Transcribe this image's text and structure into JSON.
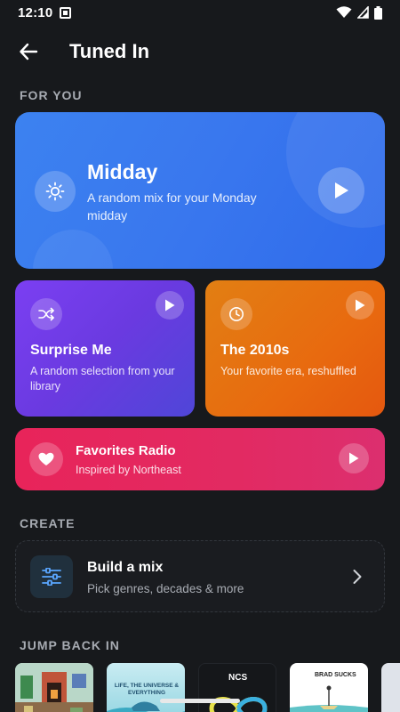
{
  "status_bar": {
    "time": "12:10"
  },
  "header": {
    "title": "Tuned In"
  },
  "sections": {
    "for_you": "FOR YOU",
    "create": "CREATE",
    "jump_back_in": "JUMP BACK IN"
  },
  "hero": {
    "title": "Midday",
    "subtitle": "A random mix for your Monday midday",
    "icon": "sun-icon",
    "color": "#3a7cf0"
  },
  "cards": [
    {
      "title": "Surprise Me",
      "subtitle": "A random selection from your library",
      "icon": "shuffle-icon",
      "color": "#6f3ee8"
    },
    {
      "title": "The 2010s",
      "subtitle": "Your favorite era, reshuffled",
      "icon": "clock-icon",
      "color": "#e8720f"
    }
  ],
  "favorites": {
    "title": "Favorites Radio",
    "subtitle": "Inspired by Northeast",
    "icon": "heart-icon",
    "color": "#e5275f"
  },
  "build_mix": {
    "title": "Build a mix",
    "subtitle": "Pick genres, decades & more",
    "icon": "sliders-icon"
  },
  "thumbnails": [
    {
      "name": "thumb-pixel-fireplace",
      "text": ""
    },
    {
      "name": "thumb-life-universe",
      "text": "LIFE, THE UNIVERSE & EVERYTHING"
    },
    {
      "name": "thumb-ncs",
      "text": "NCS"
    },
    {
      "name": "thumb-brad-sucks",
      "text": "BRAD SUCKS"
    },
    {
      "name": "thumb-partial",
      "text": ""
    }
  ]
}
